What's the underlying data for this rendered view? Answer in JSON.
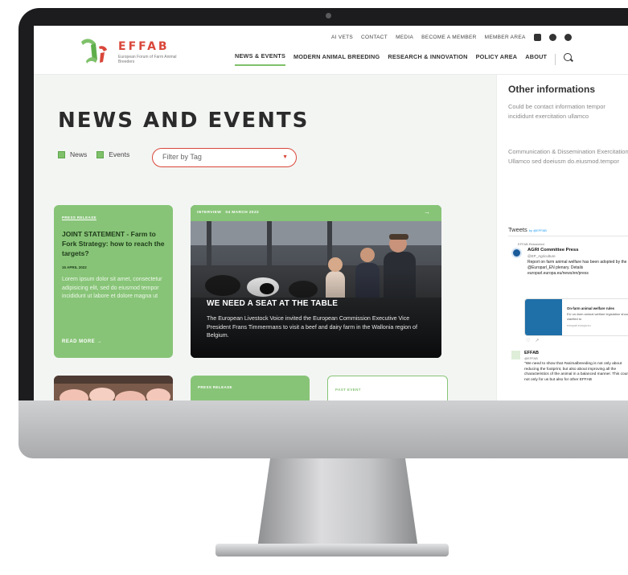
{
  "header": {
    "logo_title": "EFFAB",
    "logo_subtitle": "European Forum of Farm Animal Breeders",
    "utility_links": [
      "AI VETS",
      "CONTACT",
      "MEDIA",
      "BECOME A MEMBER",
      "MEMBER AREA"
    ],
    "main_nav": [
      "NEWS & EVENTS",
      "MODERN ANIMAL BREEDING",
      "RESEARCH & INNOVATION",
      "POLICY AREA",
      "ABOUT"
    ],
    "active_nav": "NEWS & EVENTS"
  },
  "main": {
    "page_title": "NEWS AND EVENTS",
    "filters": [
      {
        "label": "News",
        "checked": true
      },
      {
        "label": "Events",
        "checked": true
      }
    ],
    "tag_filter_placeholder": "Filter by Tag",
    "cards": {
      "card1": {
        "tag": "PRESS RELEASE",
        "title": "JOINT STATEMENT - Farm to Fork Strategy: how to reach the targets?",
        "date": "15 APRIL 2022",
        "body": "Lorem ipsum dolor sit amet, consectetur adipisicing elit, sed do eiusmod tempor incididunt ut labore et dolore magna ut",
        "read_more": "READ MORE"
      },
      "card2": {
        "tag": "INTERVIEW",
        "date": "04 MARCH 2022",
        "title": "WE NEED A SEAT AT THE TABLE",
        "body": "The European Livestock Voice invited the European Commission Executive Vice President Frans Timmermans to visit a beef and dairy farm in the Wallonia region of Belgium."
      },
      "card4": {
        "tag": "PRESS RELEASE"
      },
      "card5": {
        "tag": "PAST EVENT"
      }
    }
  },
  "sidebar": {
    "title": "Other informations",
    "text1": "Could be contact information tempor incididunt exercitation ullamco",
    "text2": "Communication & Dissemination Exercitation Ullamco sed doeiusm do.eiusmod.tempor",
    "tweets_heading": "Tweets",
    "tweets_by": "by @EFFAB",
    "tweet1": {
      "retweet_label": "EFFAB Retweeted",
      "name": "AGRI Committee Press",
      "handle": "@EP_Agriculture",
      "text": "Report on farm animal welfare has been adopted by the @Europarl_EN plenary. Details europarl.europa.eu/news/en/press"
    },
    "tweet_card": {
      "title": "On-farm animal welfare rules",
      "text": "EU on-farm animal welfare legislation should be clarified to",
      "source": "europarl.europa.eu"
    },
    "tweet2": {
      "name": "EFFAB",
      "handle": "@EFFAB",
      "text": "\"We need to show that #animalbreeding is not only about reducing the footprint, but also about improving all the characteristics of the animal in a balanced manner. This counts not only for us but also for other EFFAB"
    }
  },
  "colors": {
    "accent_green": "#87c477",
    "brand_red": "#d9473a",
    "dark": "#2b2b2b"
  }
}
